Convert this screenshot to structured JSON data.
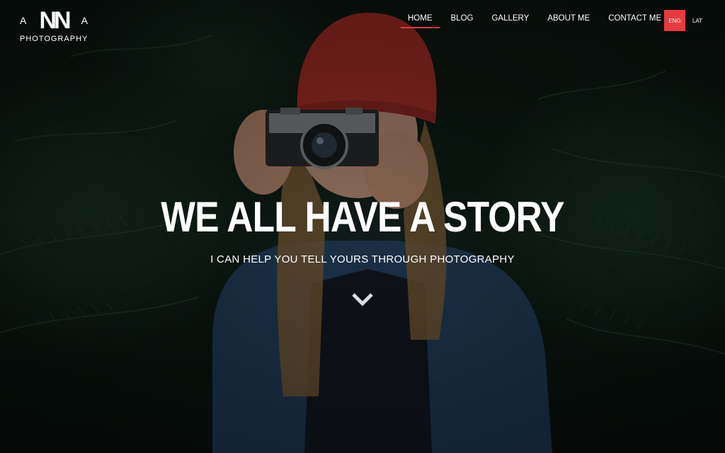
{
  "logo": {
    "left_letter": "A",
    "center_letters": "NN",
    "right_letter": "A",
    "subtitle": "PHOTOGRAPHY"
  },
  "nav": {
    "items": [
      {
        "label": "HOME",
        "active": true
      },
      {
        "label": "BLOG",
        "active": false
      },
      {
        "label": "GALLERY",
        "active": false
      },
      {
        "label": "ABOUT ME",
        "active": false
      },
      {
        "label": "CONTACT ME",
        "active": false
      }
    ]
  },
  "languages": [
    {
      "label": "ENG",
      "active": true
    },
    {
      "label": "LAT",
      "active": false
    }
  ],
  "hero": {
    "headline": "WE ALL HAVE A STORY",
    "subline": "I CAN HELP YOU TELL YOURS THROUGH PHOTOGRAPHY",
    "scroll_icon": "chevron-down-icon"
  },
  "colors": {
    "accent": "#e63a3f",
    "text": "#ffffff",
    "background": "#0f1a14"
  }
}
